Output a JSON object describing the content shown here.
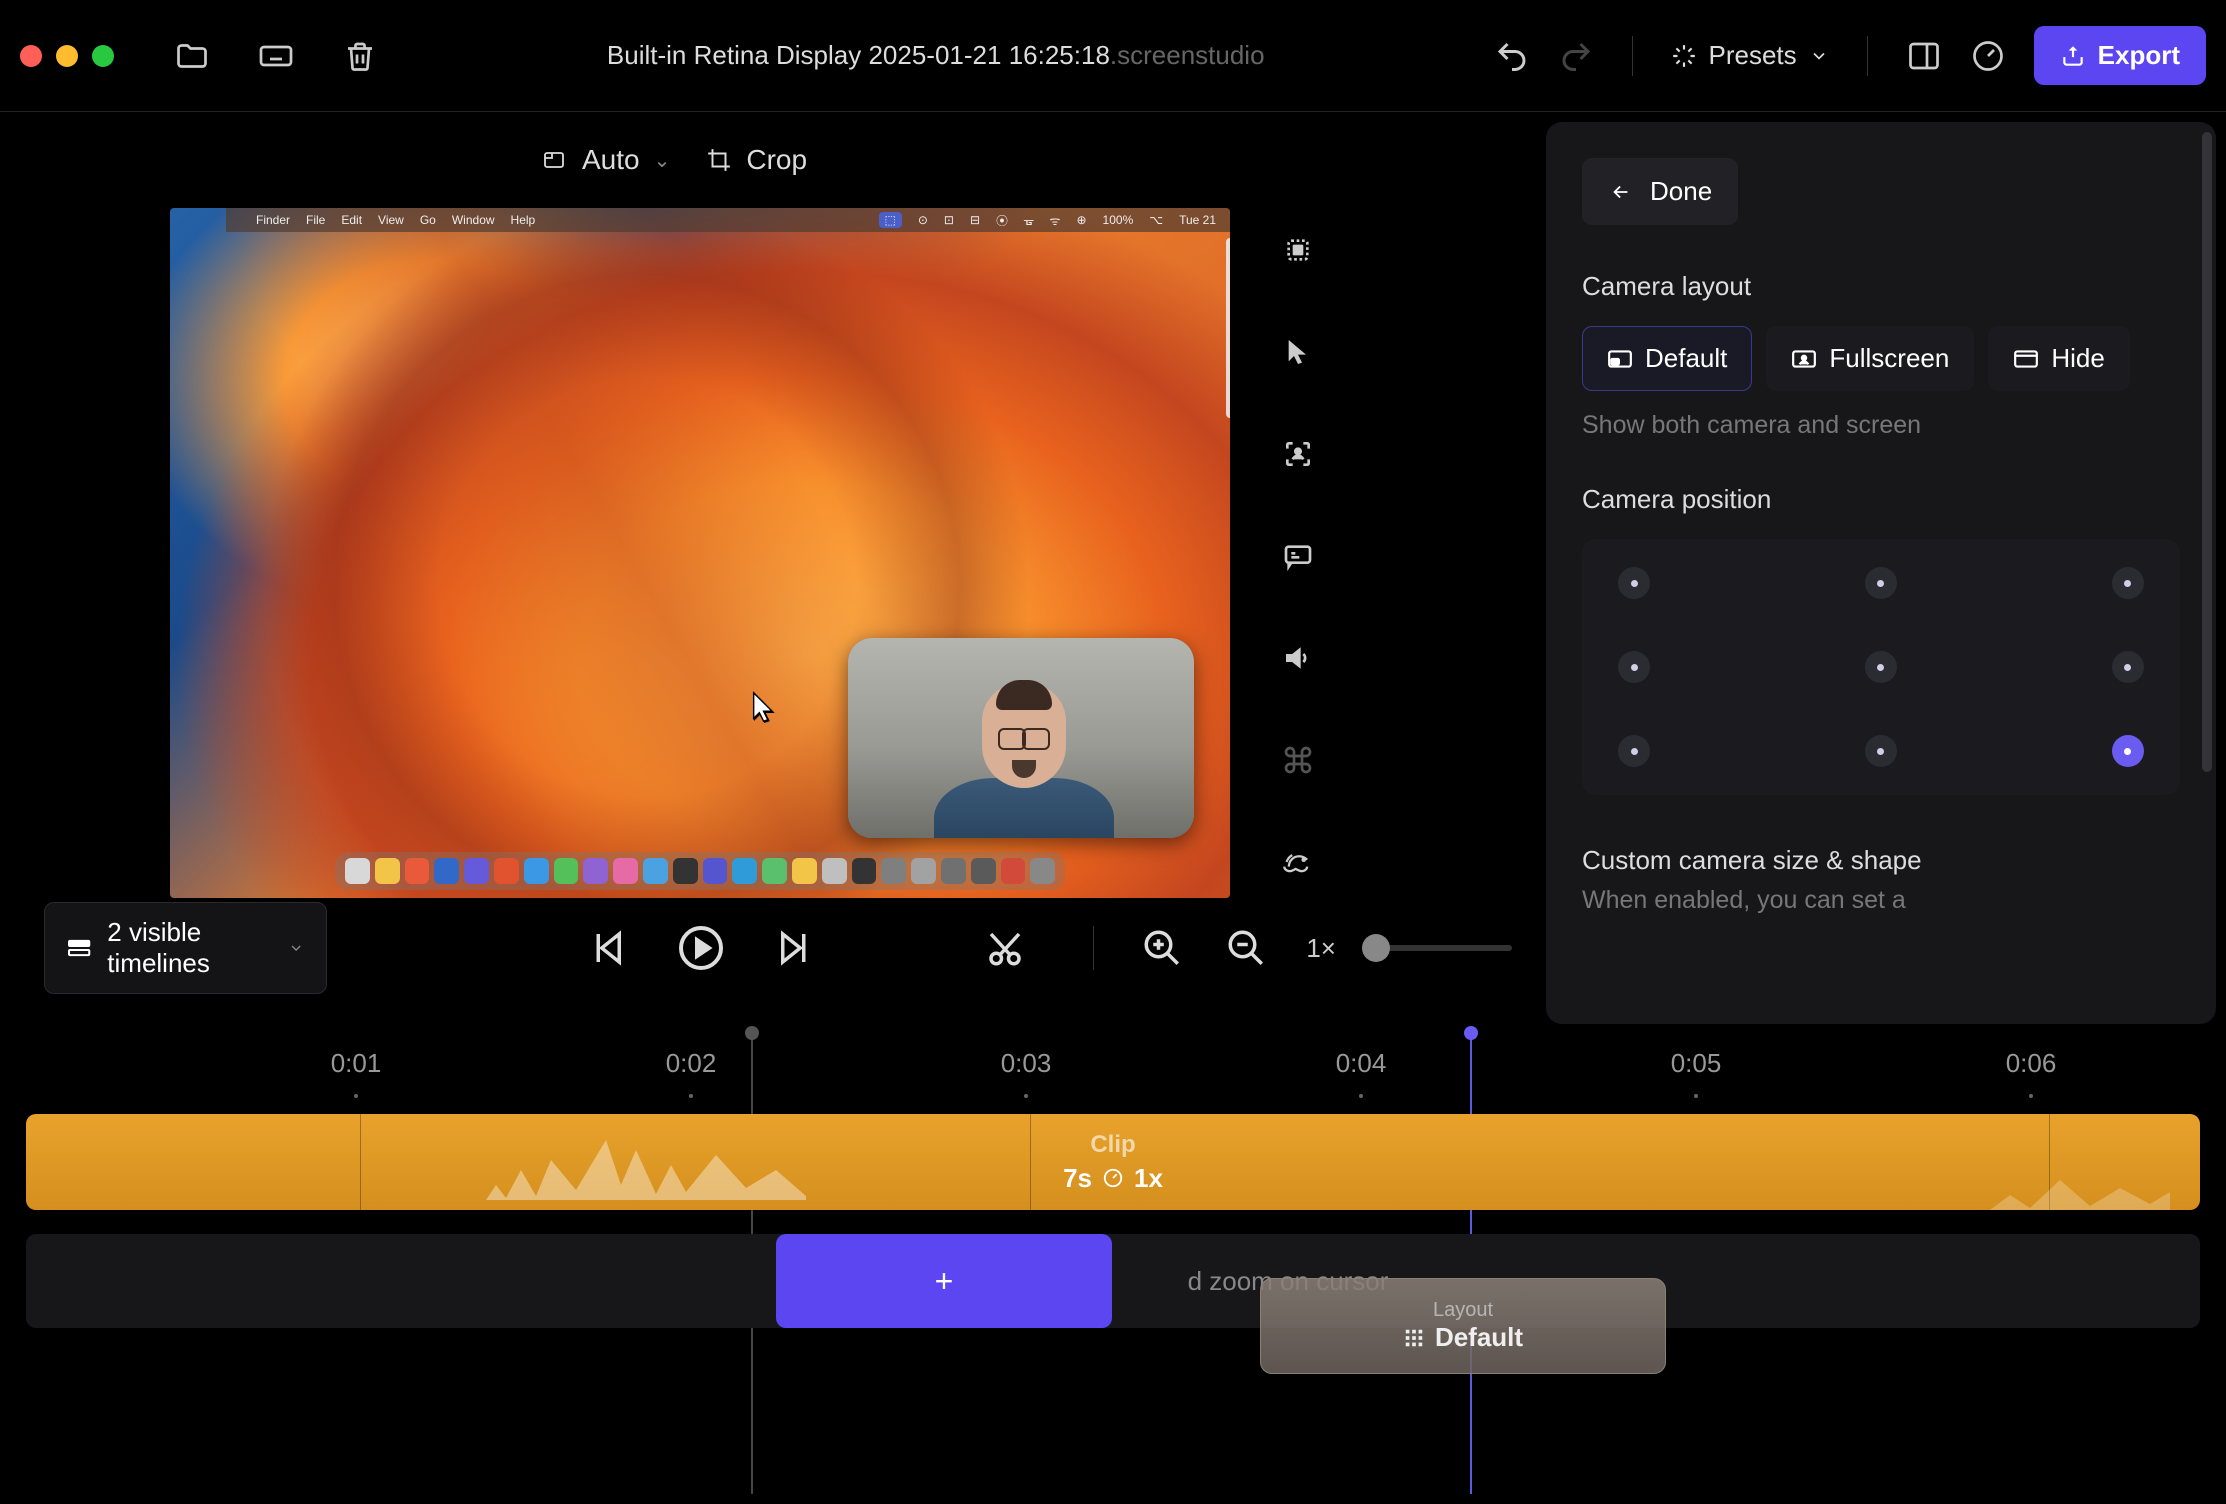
{
  "titlebar": {
    "filename": "Built-in Retina Display 2025-01-21 16:25:18",
    "extension": ".screenstudio",
    "presets_label": "Presets",
    "export_label": "Export"
  },
  "preview": {
    "size_mode": "Auto",
    "crop_label": "Crop",
    "mac_menu": [
      "Finder",
      "File",
      "Edit",
      "View",
      "Go",
      "Window",
      "Help"
    ],
    "mac_right": [
      "100%",
      "Tue 21"
    ],
    "dock_colors": [
      "#d8d8d8",
      "#f2c447",
      "#e85a3a",
      "#3268c7",
      "#655ad9",
      "#e0532e",
      "#3b98e5",
      "#53c05a",
      "#8f63d1",
      "#e66aa5",
      "#4aa3e0",
      "#333",
      "#5555cf",
      "#2f9bd8",
      "#5ac06e",
      "#f2c447",
      "#bfbfbf",
      "#333",
      "#7f7f7f",
      "#a2a2a2",
      "#707070",
      "#5a5a5a",
      "#d24a3a",
      "#888"
    ]
  },
  "rail": {
    "items": [
      "selection",
      "cursor",
      "camera-focus",
      "captions",
      "audio",
      "shortcuts",
      "speed"
    ]
  },
  "panel": {
    "done_label": "Done",
    "camera_layout_label": "Camera layout",
    "layout_options": {
      "default": "Default",
      "fullscreen": "Fullscreen",
      "hide": "Hide"
    },
    "layout_hint": "Show both camera and screen",
    "camera_position_label": "Camera position",
    "position_selected": "bottom-right",
    "custom_size_label": "Custom camera size & shape",
    "custom_size_hint": "When enabled, you can set a"
  },
  "playback": {
    "timelines_label": "2 visible timelines",
    "zoom_label": "1×"
  },
  "timeline": {
    "ticks": [
      "0:01",
      "0:02",
      "0:03",
      "0:04",
      "0:05",
      "0:06"
    ],
    "clip_title": "Clip",
    "clip_duration": "7s",
    "clip_speed": "1x",
    "zoom_hint": "d zoom on cursor",
    "add_label": "+",
    "layout_chip_title": "Layout",
    "layout_chip_value": "Default"
  }
}
